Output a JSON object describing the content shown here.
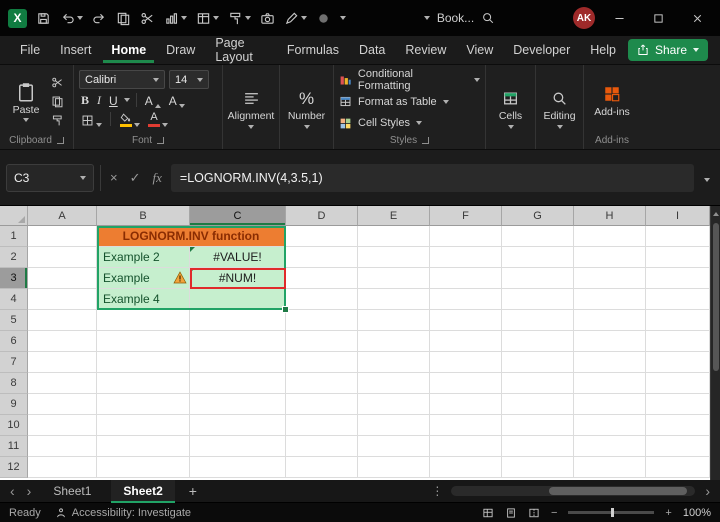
{
  "titlebar": {
    "search_text": "Book...",
    "avatar_initials": "AK",
    "app_logo": "X"
  },
  "menubar": {
    "tabs": [
      "File",
      "Insert",
      "Home",
      "Draw",
      "Page Layout",
      "Formulas",
      "Data",
      "Review",
      "View",
      "Developer",
      "Help"
    ],
    "active_tab": "Home",
    "share_label": "Share"
  },
  "ribbon": {
    "paste_label": "Paste",
    "font_name": "Calibri",
    "font_size": "14",
    "bold": "B",
    "italic": "I",
    "underline": "U",
    "font_letter": "A",
    "percent": "%",
    "styles_buttons": [
      "Conditional Formatting",
      "Format as Table",
      "Cell Styles"
    ],
    "groups": {
      "clipboard": "Clipboard",
      "font": "Font",
      "alignment": "Alignment",
      "number": "Number",
      "styles": "Styles",
      "cells": "Cells",
      "editing": "Editing",
      "addins": "Add-ins"
    }
  },
  "formula_bar": {
    "name_box": "C3",
    "fx": "fx",
    "formula": "=LOGNORM.INV(4,3.5,1)"
  },
  "grid": {
    "columns": [
      "A",
      "B",
      "C",
      "D",
      "E",
      "F",
      "G",
      "H",
      "I"
    ],
    "rows": [
      "1",
      "2",
      "3",
      "4",
      "5",
      "6",
      "7",
      "8",
      "9",
      "10",
      "11",
      "12"
    ],
    "selected_column": "C",
    "selected_row": "3",
    "merged_title_ref": "B1",
    "highlight_range": "B1:C4",
    "error_cell": "C3",
    "cells": {
      "B1": "LOGNORM.INV function",
      "B2": "Example 2",
      "C2": "#VALUE!",
      "B3": "Example",
      "C3": "#NUM!",
      "B4": "Example 4"
    }
  },
  "sheet_bar": {
    "tabs": [
      "Sheet1",
      "Sheet2"
    ],
    "active_tab": "Sheet2"
  },
  "status_bar": {
    "mode": "Ready",
    "accessibility": "Accessibility: Investigate",
    "zoom": "100%"
  },
  "icons": {
    "cancel": "×",
    "enter": "✓",
    "add_sheet": "+",
    "nav_left": "‹",
    "nav_right": "›",
    "ellipsis": "⋮",
    "minus": "−",
    "plus": "+"
  },
  "colors": {
    "accent_green": "#21A366",
    "title_fill": "#ED7D31",
    "good_fill": "#C6EFCE",
    "error_border": "#E02B2B"
  }
}
